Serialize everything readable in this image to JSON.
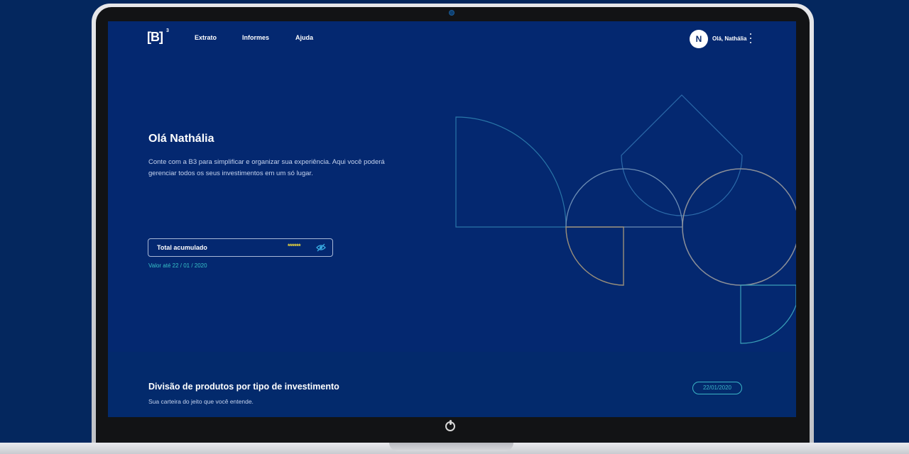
{
  "nav": {
    "logo": "[B]",
    "logo_sup": "3",
    "items": [
      "Extrato",
      "Informes",
      "Ajuda"
    ],
    "avatar_initial": "N",
    "user_name": "Olá, Nathália"
  },
  "hero": {
    "greeting": "Olá Nathália",
    "intro": "Conte com a B3 para simplificar e organizar sua experiência. Aqui você poderá gerenciar todos os seus investimentos em um só lugar.",
    "total_label": "Total acumulado",
    "total_masked": "******",
    "valor_date": "Valor até 22 / 01 / 2020"
  },
  "section": {
    "title": "Divisão de produtos por tipo de investimento",
    "subtitle": "Sua carteira do jeito que você entende.",
    "date": "22/01/2020"
  },
  "colors": {
    "background": "#04275e",
    "screen": "#042870",
    "accent_teal": "#37c2c8",
    "mask_yellow": "#f3dc3b"
  },
  "icons": {
    "eye": "eye-slash-icon",
    "menu": "kebab-menu-icon",
    "power": "power-icon"
  }
}
